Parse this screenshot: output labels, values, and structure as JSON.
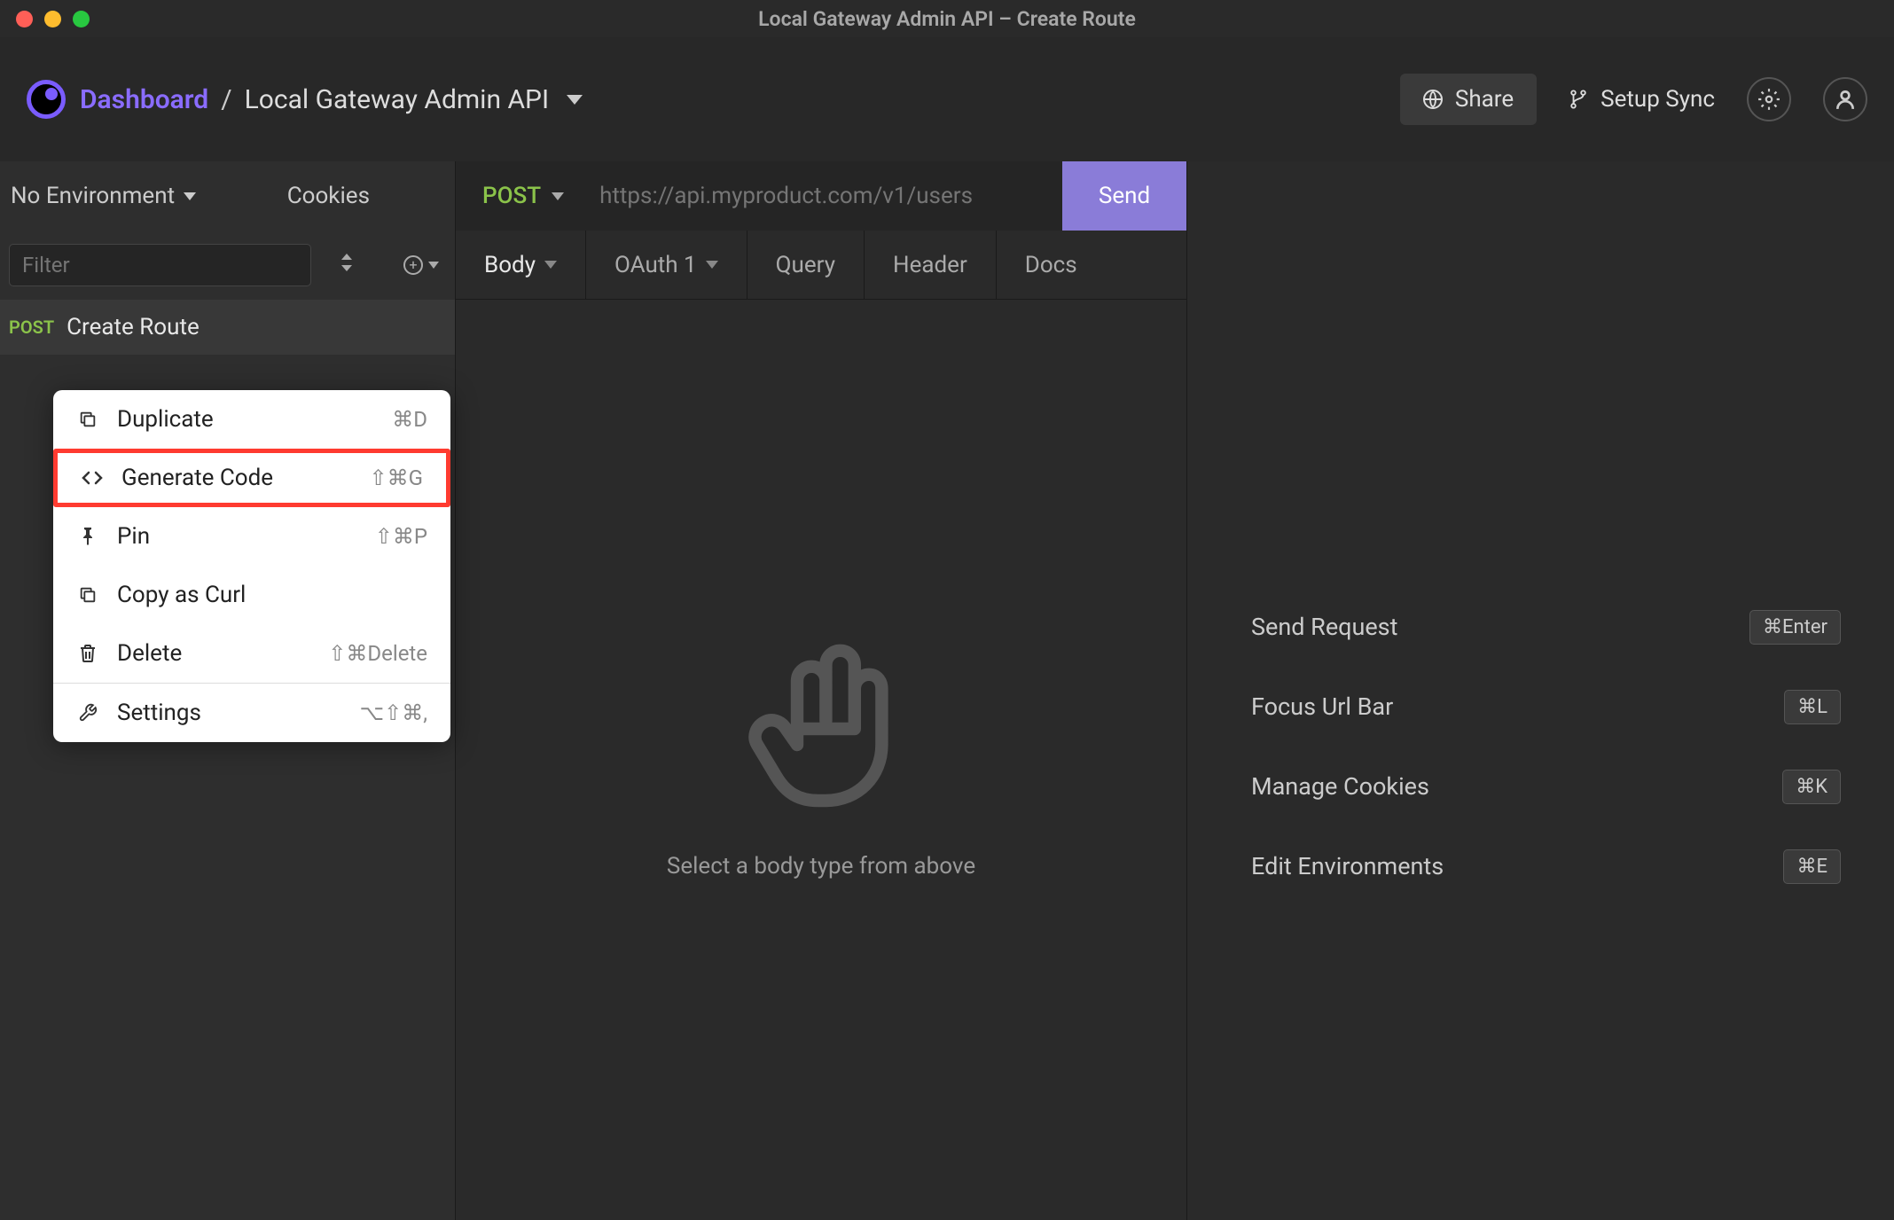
{
  "window": {
    "title": "Local Gateway Admin API – Create Route"
  },
  "header": {
    "breadcrumb": {
      "root": "Dashboard",
      "separator": "/",
      "current": "Local Gateway Admin API"
    },
    "share_label": "Share",
    "sync_label": "Setup Sync"
  },
  "sidebar": {
    "environment_label": "No Environment",
    "cookies_label": "Cookies",
    "filter_placeholder": "Filter",
    "request": {
      "method": "POST",
      "name": "Create Route"
    },
    "context_menu": [
      {
        "icon": "⧉",
        "label": "Duplicate",
        "shortcut": "⌘D"
      },
      {
        "icon": "</>",
        "label": "Generate Code",
        "shortcut": "⇧⌘G",
        "highlighted": true
      },
      {
        "icon": "📌",
        "label": "Pin",
        "shortcut": "⇧⌘P"
      },
      {
        "icon": "⧉",
        "label": "Copy as Curl",
        "shortcut": ""
      },
      {
        "icon": "🗑",
        "label": "Delete",
        "shortcut": "⇧⌘Delete"
      },
      {
        "divider": true
      },
      {
        "icon": "🔧",
        "label": "Settings",
        "shortcut": "⌥⇧⌘,"
      }
    ]
  },
  "request": {
    "method": "POST",
    "url_placeholder": "https://api.myproduct.com/v1/users",
    "send_label": "Send",
    "tabs": [
      {
        "label": "Body",
        "dropdown": true,
        "active": true
      },
      {
        "label": "OAuth 1",
        "dropdown": true
      },
      {
        "label": "Query"
      },
      {
        "label": "Header"
      },
      {
        "label": "Docs"
      }
    ],
    "body_placeholder": "Select a body type from above"
  },
  "response": {
    "shortcuts": [
      {
        "label": "Send Request",
        "key": "⌘Enter"
      },
      {
        "label": "Focus Url Bar",
        "key": "⌘L"
      },
      {
        "label": "Manage Cookies",
        "key": "⌘K"
      },
      {
        "label": "Edit Environments",
        "key": "⌘E"
      }
    ]
  }
}
